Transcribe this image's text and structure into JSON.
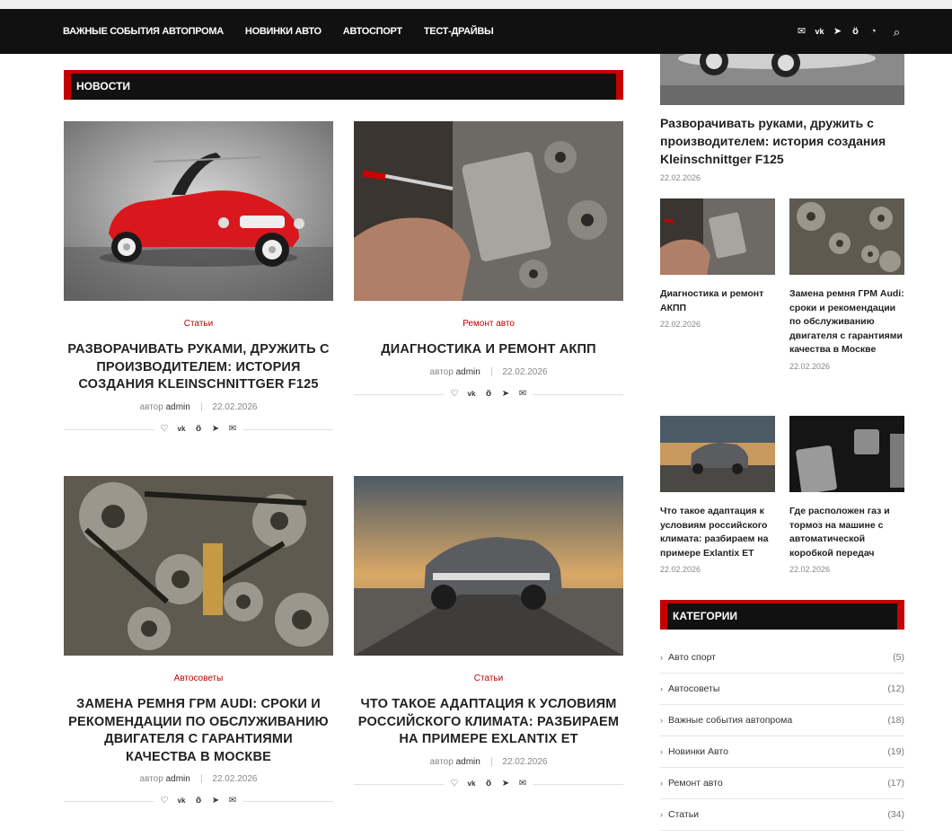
{
  "nav": {
    "items": [
      "ВАЖНЫЕ СОБЫТИЯ АВТОПРОМА",
      "НОВИНКИ АВТО",
      "АВТОСПОРТ",
      "ТЕСТ-ДРАЙВЫ"
    ],
    "icons": [
      "envelope-icon",
      "vk-icon",
      "telegram-icon",
      "odnoklassniki-icon",
      "rss-icon",
      "search-icon"
    ]
  },
  "news_section": {
    "title": "НОВОСТИ"
  },
  "posts": [
    {
      "category": "Статьи",
      "title": "РАЗВОРАЧИВАТЬ РУКАМИ, ДРУЖИТЬ С ПРОИЗВОДИТЕЛЕМ: ИСТОРИЯ СОЗДАНИЯ KLEINSCHNITTGER F125",
      "author_prefix": "автор",
      "author": "admin",
      "date": "22.02.2026"
    },
    {
      "category": "Ремонт авто",
      "title": "ДИАГНОСТИКА И РЕМОНТ АКПП",
      "author_prefix": "автор",
      "author": "admin",
      "date": "22.02.2026"
    },
    {
      "category": "Автосоветы",
      "title": "ЗАМЕНА РЕМНЯ ГРМ AUDI: СРОКИ И РЕКОМЕНДАЦИИ ПО ОБСЛУЖИВАНИЮ ДВИГАТЕЛЯ С ГАРАНТИЯМИ КАЧЕСТВА В МОСКВЕ",
      "author_prefix": "автор",
      "author": "admin",
      "date": "22.02.2026"
    },
    {
      "category": "Статьи",
      "title": "ЧТО ТАКОЕ АДАПТАЦИЯ К УСЛОВИЯМ РОССИЙСКОГО КЛИМАТА: РАЗБИРАЕМ НА ПРИМЕРЕ EXLANTIX ET",
      "author_prefix": "автор",
      "author": "admin",
      "date": "22.02.2026"
    }
  ],
  "share_icons": [
    "heart-icon",
    "vk-icon",
    "odnoklassniki-icon",
    "telegram-icon",
    "envelope-icon"
  ],
  "sidebar": {
    "featured": {
      "title": "Разворачивать руками, дружить с производителем: история создания Kleinschnittger F125",
      "date": "22.02.2026"
    },
    "small_posts": [
      {
        "title": "Диагностика и ремонт АКПП",
        "date": "22.02.2026"
      },
      {
        "title": "Замена ремня ГРМ Audi: сроки и рекомендации по обслуживанию двигателя с гарантиями качества в Москве",
        "date": "22.02.2026"
      },
      {
        "title": "Что такое адаптация к условиям российского климата: разбираем на примере Exlantix ET",
        "date": "22.02.2026"
      },
      {
        "title": "Где расположен газ и тормоз на машине с автоматической коробкой передач",
        "date": "22.02.2026"
      }
    ],
    "categories_title": "КАТЕГОРИИ",
    "categories": [
      {
        "name": "Авто спорт",
        "count": "(5)"
      },
      {
        "name": "Автосоветы",
        "count": "(12)"
      },
      {
        "name": "Важные события автопрома",
        "count": "(18)"
      },
      {
        "name": "Новинки Авто",
        "count": "(19)"
      },
      {
        "name": "Ремонт авто",
        "count": "(17)"
      },
      {
        "name": "Статьи",
        "count": "(34)"
      }
    ]
  },
  "colors": {
    "accent": "#c40000",
    "nav_bg": "#111111"
  }
}
